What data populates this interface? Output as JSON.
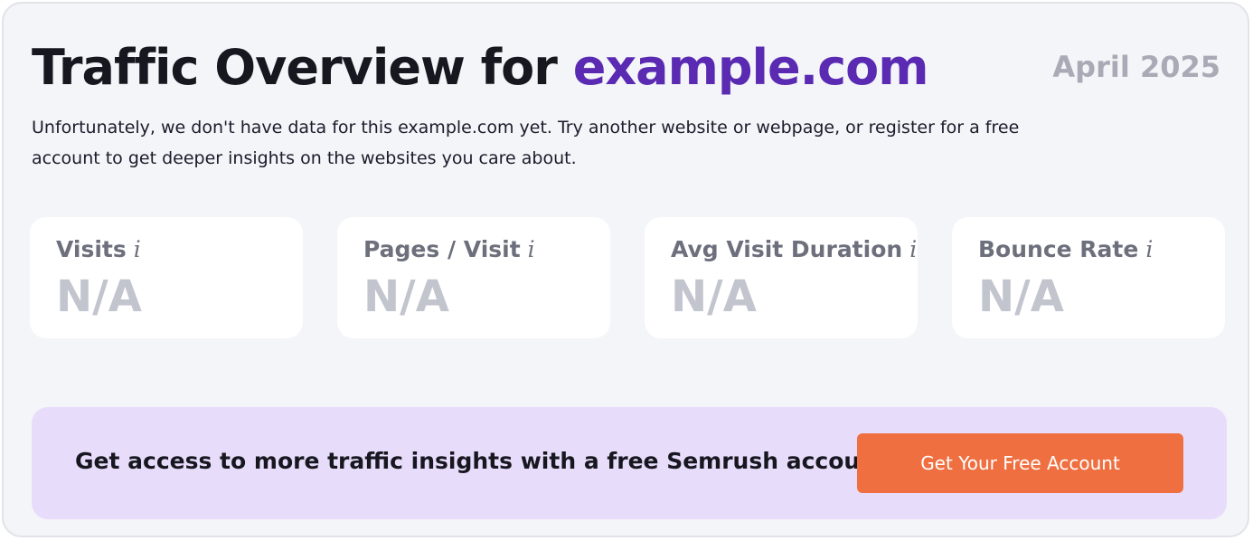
{
  "header": {
    "title_prefix": "Traffic Overview for",
    "domain": "example.com",
    "date": "April 2025"
  },
  "description": "Unfortunately, we don't have data for this example.com yet. Try another website or webpage, or register for a free account to get deeper insights on the websites you care about.",
  "metrics": [
    {
      "label": "Visits",
      "info_icon": "i",
      "value": "N/A"
    },
    {
      "label": "Pages / Visit",
      "info_icon": "i",
      "value": "N/A"
    },
    {
      "label": "Avg Visit Duration",
      "info_icon": "i",
      "value": "N/A"
    },
    {
      "label": "Bounce Rate",
      "info_icon": "i",
      "value": "N/A"
    }
  ],
  "banner": {
    "text": "Get access to more traffic insights with a free Semrush account",
    "button_label": "Get Your Free Account"
  },
  "colors": {
    "accent": "#5b2ab2",
    "cta": "#ef6f40",
    "banner_bg": "#e8dcfb",
    "card_bg": "#f4f5f8"
  }
}
